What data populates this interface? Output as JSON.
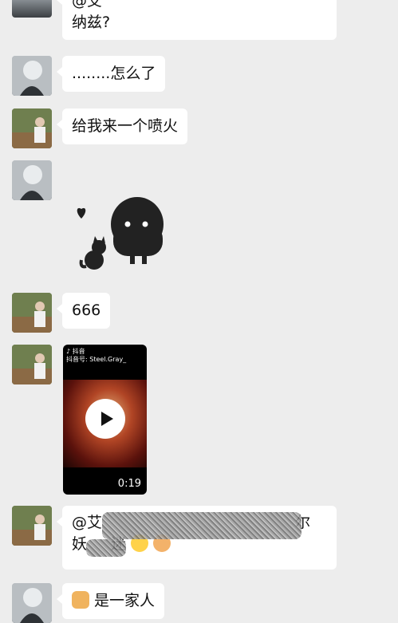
{
  "messages": [
    {
      "type": "text",
      "text": "@艾",
      "continuation": "纳兹?"
    },
    {
      "type": "text",
      "text": "........怎么了"
    },
    {
      "type": "text",
      "text": "给我来一个喷火"
    },
    {
      "type": "sticker",
      "name": "black-cat-ghost-sticker"
    },
    {
      "type": "text",
      "text": "666"
    },
    {
      "type": "video",
      "brand": "抖音",
      "account": "抖音号: Steel.Gray_",
      "duration": "0:19"
    },
    {
      "type": "text",
      "text_line1_start": "@艾",
      "text_line1_end": "尔",
      "text_line2_start": "妖",
      "text_line2_mid": "迷"
    },
    {
      "type": "text",
      "text": "是一家人"
    }
  ],
  "colors": {
    "background": "#ededed",
    "bubble": "#ffffff"
  }
}
